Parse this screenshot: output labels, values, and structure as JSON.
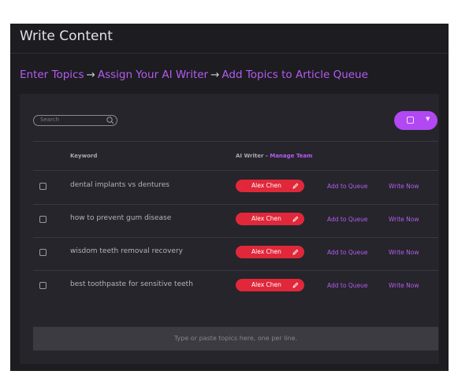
{
  "page": {
    "title": "Write Content"
  },
  "steps": {
    "step1": "Enter Topics",
    "step2": "Assign Your AI Writer",
    "step3": "Add Topics to Article Queue",
    "arrow": "→"
  },
  "search": {
    "placeholder": "Search"
  },
  "table": {
    "col_keyword": "Keyword",
    "col_writer": "AI Writer - ",
    "manage_team": "Manage Team",
    "rows": [
      {
        "keyword": "dental implants vs dentures",
        "writer": "Alex Chen",
        "add_queue": "Add to Queue",
        "write_now": "Write Now"
      },
      {
        "keyword": "how to prevent gum disease",
        "writer": "Alex Chen",
        "add_queue": "Add to Queue",
        "write_now": "Write Now"
      },
      {
        "keyword": "wisdom teeth removal recovery",
        "writer": "Alex Chen",
        "add_queue": "Add to Queue",
        "write_now": "Write Now"
      },
      {
        "keyword": "best toothpaste for sensitive teeth",
        "writer": "Alex Chen",
        "add_queue": "Add to Queue",
        "write_now": "Write Now"
      }
    ]
  },
  "paste": {
    "placeholder": "Type or paste topics here, one per line."
  },
  "icons": {
    "search": "search-icon",
    "pencil": "pencil-icon",
    "checkbox": "checkbox-icon",
    "dropdown": "chevron-down-icon"
  },
  "colors": {
    "accent": "#b35cf2",
    "writer_badge": "#e0283a",
    "bulk_button": "#b148f2",
    "panel": "#1d1c20",
    "card": "#26252b"
  }
}
